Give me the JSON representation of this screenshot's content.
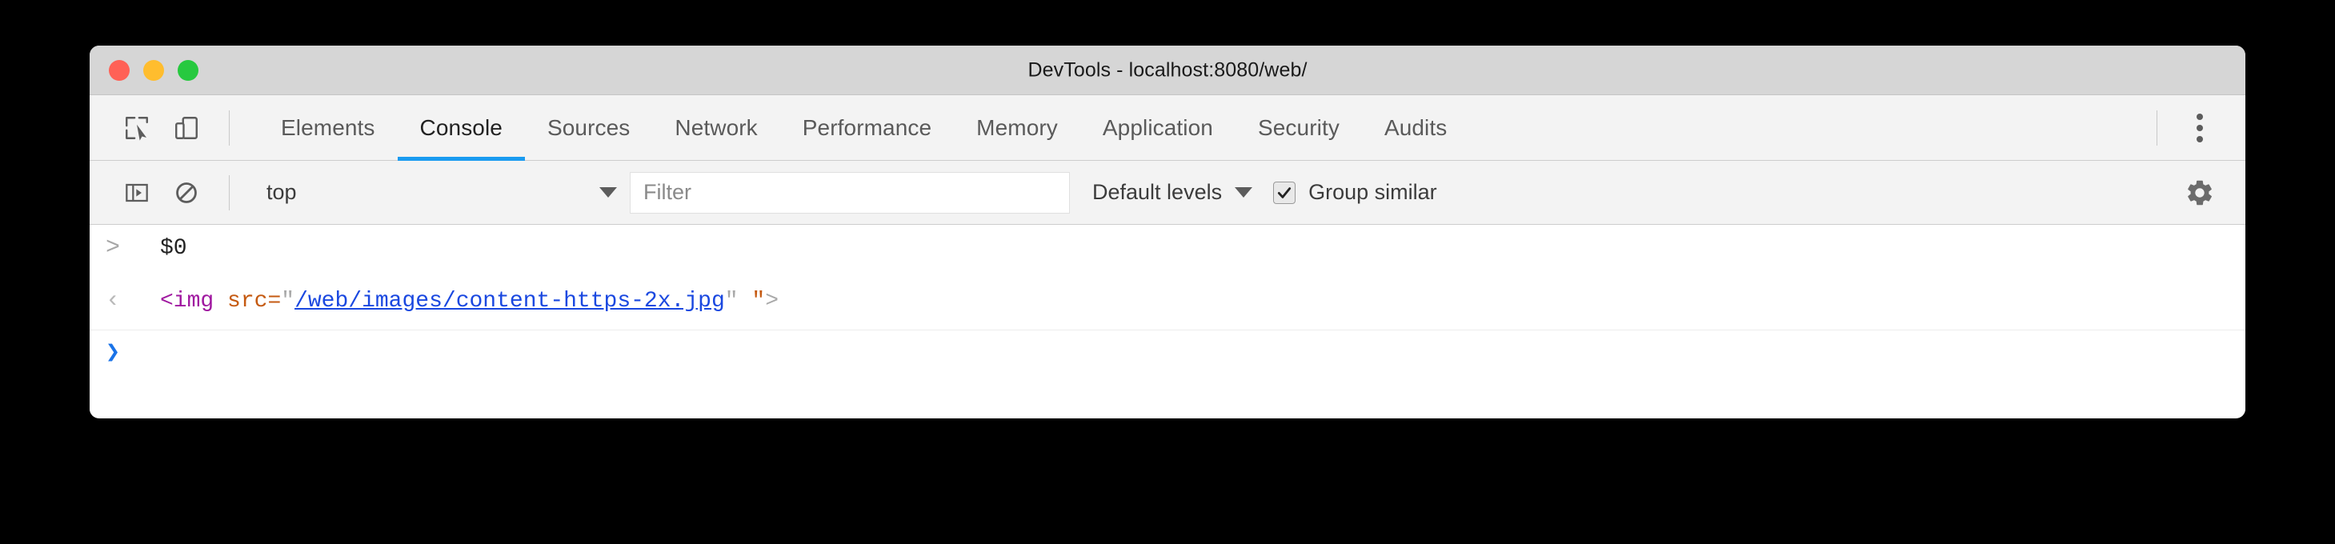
{
  "window": {
    "title": "DevTools - localhost:8080/web/",
    "traffic_lights": [
      {
        "name": "close",
        "color": "#ff6156"
      },
      {
        "name": "minimize",
        "color": "#ffbd2e"
      },
      {
        "name": "zoom",
        "color": "#27c93f"
      }
    ]
  },
  "toolbar": {
    "inspect_icon": "inspect-element-icon",
    "device_icon": "device-toolbar-icon",
    "more_icon": "more-options-kebab-icon",
    "tabs": [
      {
        "label": "Elements",
        "active": false
      },
      {
        "label": "Console",
        "active": true
      },
      {
        "label": "Sources",
        "active": false
      },
      {
        "label": "Network",
        "active": false
      },
      {
        "label": "Performance",
        "active": false
      },
      {
        "label": "Memory",
        "active": false
      },
      {
        "label": "Application",
        "active": false
      },
      {
        "label": "Security",
        "active": false
      },
      {
        "label": "Audits",
        "active": false
      }
    ],
    "active_tab_underline_color": "#1a9bf0"
  },
  "filterbar": {
    "sidebar_icon": "console-sidebar-toggle-icon",
    "clear_icon": "clear-console-icon",
    "context": {
      "value": "top",
      "caret": "chevron-down-icon"
    },
    "filter": {
      "value": "",
      "placeholder": "Filter"
    },
    "levels": {
      "label": "Default levels",
      "caret": "chevron-down-icon"
    },
    "group_similar": {
      "label": "Group similar",
      "checked": true
    },
    "settings_icon": "settings-gear-icon"
  },
  "console": {
    "rows": [
      {
        "type": "input",
        "gutter": ">",
        "text": "$0"
      },
      {
        "type": "output",
        "gutter": "‹",
        "tokens": {
          "open_tag": "<img",
          "space1": " ",
          "attr": "src=",
          "quote_open": "\"",
          "link": "/web/images/content-https-2x.jpg",
          "quote_close": "\"",
          "space2": " ",
          "quote_orange": "\"",
          "close_tag": ">"
        },
        "plain": "<img src=\"/web/images/content-https-2x.jpg\" \">"
      },
      {
        "type": "prompt",
        "gutter": "❯",
        "text": ""
      }
    ]
  }
}
